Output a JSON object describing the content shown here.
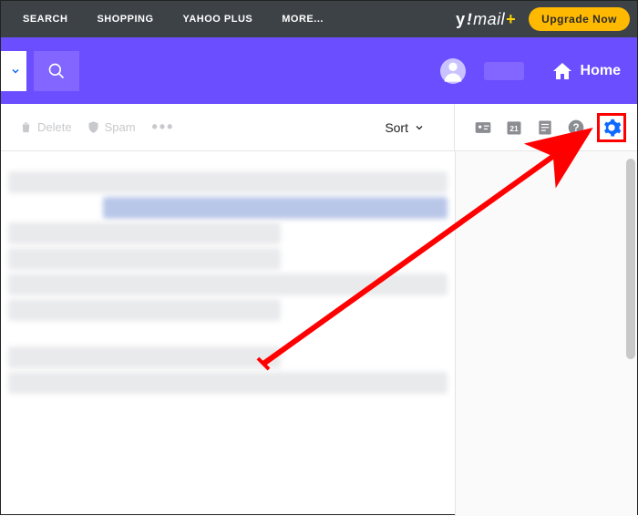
{
  "topnav": {
    "items": [
      "SEARCH",
      "SHOPPING",
      "YAHOO PLUS",
      "MORE..."
    ],
    "brand_y": "y",
    "brand_excl": "!",
    "brand_text": "mail",
    "brand_plus": "+",
    "upgrade": "Upgrade Now"
  },
  "hero": {
    "home": "Home"
  },
  "toolbar": {
    "delete": "Delete",
    "spam": "Spam",
    "overflow": "•••",
    "sort": "Sort"
  },
  "colors": {
    "accent": "#6b4eff",
    "gear": "#0f69ff",
    "highlight_border": "#ff0000",
    "upgrade_bg": "#ffb900"
  }
}
